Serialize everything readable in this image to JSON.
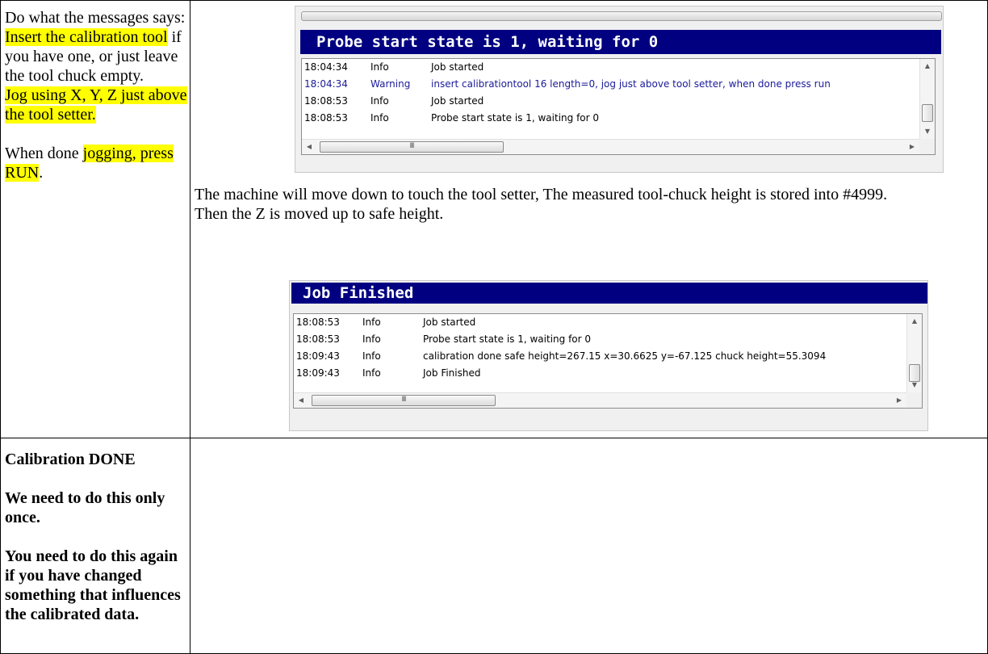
{
  "left_cell": {
    "p1_plain": "Do what the messages says: ",
    "p1_hl1": "Insert the calibration tool",
    "p1_rest": " if you have one, or just leave the tool chuck empty.",
    "p1_hl2": "Jog using X, Y, Z just above the tool setter.",
    "p2_plain": "When done ",
    "p2_hl": "jogging, press RUN",
    "p2_end": "."
  },
  "top_panel": {
    "status": "Probe start state is 1, waiting for 0",
    "log": [
      {
        "time": "18:04:34",
        "level": "Info",
        "message": "Job started",
        "warning": false
      },
      {
        "time": "18:04:34",
        "level": "Warning",
        "message": "insert calibrationtool 16 length=0, jog just above tool setter, when done press run",
        "warning": true
      },
      {
        "time": "18:08:53",
        "level": "Info",
        "message": "Job started",
        "warning": false
      },
      {
        "time": "18:08:53",
        "level": "Info",
        "message": "Probe start state is 1, waiting for 0",
        "warning": false
      }
    ],
    "hscroll_grip": "III"
  },
  "description": {
    "line1": "The machine will move down to touch the tool setter, The measured tool-chuck height is stored into #4999.",
    "line2": "Then the Z is moved up to safe height."
  },
  "bottom_panel": {
    "status": "Job Finished",
    "log": [
      {
        "time": "18:08:53",
        "level": "Info",
        "message": "Job started"
      },
      {
        "time": "18:08:53",
        "level": "Info",
        "message": "Probe start state is 1, waiting for 0"
      },
      {
        "time": "18:09:43",
        "level": "Info",
        "message": "calibration done safe height=267.15 x=30.6625 y=-67.125 chuck height=55.3094"
      },
      {
        "time": "18:09:43",
        "level": "Info",
        "message": "Job Finished"
      }
    ],
    "hscroll_grip": "III"
  },
  "bottom_cell": {
    "title": "Calibration DONE",
    "line2": "We need to do this only once.",
    "line3": "You need to do this again if you have changed something that influences the calibrated data."
  },
  "icons": {
    "scroll_up": "▲",
    "scroll_down": "▼",
    "scroll_left": "◀",
    "scroll_right": "▶"
  }
}
